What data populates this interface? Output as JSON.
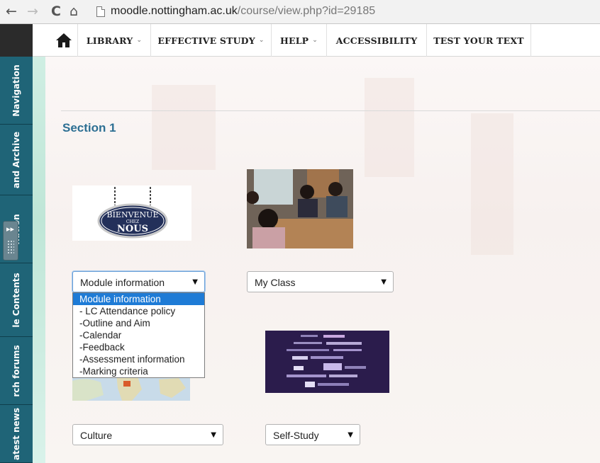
{
  "browser": {
    "back_glyph": "←",
    "forward_glyph": "→",
    "reload_glyph": "C",
    "home_glyph": "⌂",
    "url_host": "moodle.nottingham.ac.uk",
    "url_path": "/course/view.php?id=29185"
  },
  "dock": {
    "tabs": [
      "Navigation",
      "and Archive",
      "nation",
      "le Contents",
      "rch forums",
      "atest news"
    ],
    "handle_arrow": "▸▸"
  },
  "nav": {
    "items": [
      {
        "label": "LIBRARY",
        "caret": "⌄"
      },
      {
        "label": "EFFECTIVE STUDY",
        "caret": "⌄"
      },
      {
        "label": "HELP",
        "caret": "⌄"
      },
      {
        "label": "ACCESSIBILITY",
        "caret": ""
      },
      {
        "label": "TEST YOUR TEXT",
        "caret": ""
      }
    ]
  },
  "section": {
    "title": "Section 1"
  },
  "images": {
    "sign_text_top": "BIENVENUE",
    "sign_text_mid": "CHEZ",
    "sign_text_bottom": "NOUS"
  },
  "selects": {
    "module_info": {
      "value": "Module information",
      "arrow": "▼"
    },
    "my_class": {
      "value": "My Class",
      "arrow": "▼"
    },
    "culture": {
      "value": "Culture",
      "arrow": "▼"
    },
    "self_study": {
      "value": "Self-Study",
      "arrow": "▼"
    }
  },
  "dropdown": {
    "options": [
      "Module information",
      " - LC Attendance policy",
      "-Outline and Aim",
      "-Calendar",
      "-Feedback",
      "-Assessment information",
      "-Marking criteria"
    ],
    "selected_index": 0
  },
  "colors": {
    "dock": "#1f6477",
    "section_title": "#2d6f93",
    "dropdown_selected": "#1e7bd6"
  }
}
